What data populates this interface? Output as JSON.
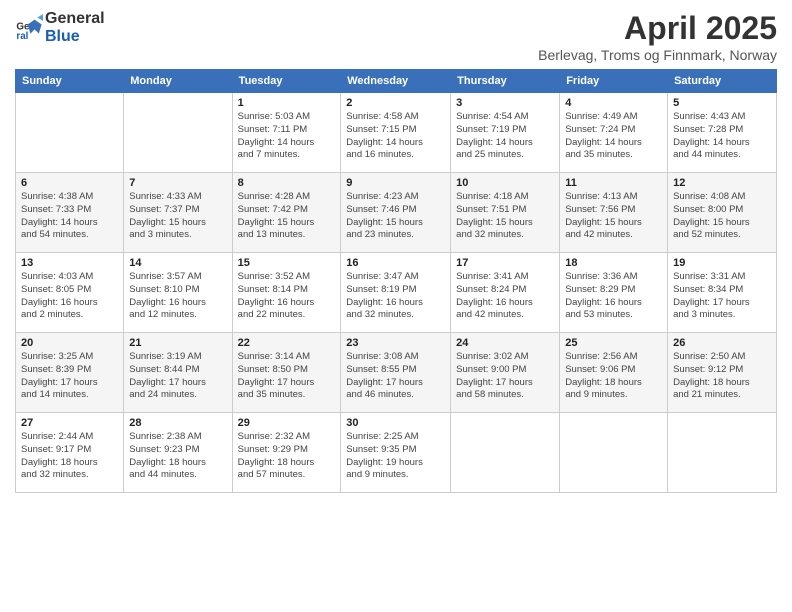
{
  "logo": {
    "text_general": "General",
    "text_blue": "Blue"
  },
  "title": "April 2025",
  "location": "Berlevag, Troms og Finnmark, Norway",
  "days_of_week": [
    "Sunday",
    "Monday",
    "Tuesday",
    "Wednesday",
    "Thursday",
    "Friday",
    "Saturday"
  ],
  "weeks": [
    [
      {
        "day": "",
        "info": ""
      },
      {
        "day": "",
        "info": ""
      },
      {
        "day": "1",
        "info": "Sunrise: 5:03 AM\nSunset: 7:11 PM\nDaylight: 14 hours\nand 7 minutes."
      },
      {
        "day": "2",
        "info": "Sunrise: 4:58 AM\nSunset: 7:15 PM\nDaylight: 14 hours\nand 16 minutes."
      },
      {
        "day": "3",
        "info": "Sunrise: 4:54 AM\nSunset: 7:19 PM\nDaylight: 14 hours\nand 25 minutes."
      },
      {
        "day": "4",
        "info": "Sunrise: 4:49 AM\nSunset: 7:24 PM\nDaylight: 14 hours\nand 35 minutes."
      },
      {
        "day": "5",
        "info": "Sunrise: 4:43 AM\nSunset: 7:28 PM\nDaylight: 14 hours\nand 44 minutes."
      }
    ],
    [
      {
        "day": "6",
        "info": "Sunrise: 4:38 AM\nSunset: 7:33 PM\nDaylight: 14 hours\nand 54 minutes."
      },
      {
        "day": "7",
        "info": "Sunrise: 4:33 AM\nSunset: 7:37 PM\nDaylight: 15 hours\nand 3 minutes."
      },
      {
        "day": "8",
        "info": "Sunrise: 4:28 AM\nSunset: 7:42 PM\nDaylight: 15 hours\nand 13 minutes."
      },
      {
        "day": "9",
        "info": "Sunrise: 4:23 AM\nSunset: 7:46 PM\nDaylight: 15 hours\nand 23 minutes."
      },
      {
        "day": "10",
        "info": "Sunrise: 4:18 AM\nSunset: 7:51 PM\nDaylight: 15 hours\nand 32 minutes."
      },
      {
        "day": "11",
        "info": "Sunrise: 4:13 AM\nSunset: 7:56 PM\nDaylight: 15 hours\nand 42 minutes."
      },
      {
        "day": "12",
        "info": "Sunrise: 4:08 AM\nSunset: 8:00 PM\nDaylight: 15 hours\nand 52 minutes."
      }
    ],
    [
      {
        "day": "13",
        "info": "Sunrise: 4:03 AM\nSunset: 8:05 PM\nDaylight: 16 hours\nand 2 minutes."
      },
      {
        "day": "14",
        "info": "Sunrise: 3:57 AM\nSunset: 8:10 PM\nDaylight: 16 hours\nand 12 minutes."
      },
      {
        "day": "15",
        "info": "Sunrise: 3:52 AM\nSunset: 8:14 PM\nDaylight: 16 hours\nand 22 minutes."
      },
      {
        "day": "16",
        "info": "Sunrise: 3:47 AM\nSunset: 8:19 PM\nDaylight: 16 hours\nand 32 minutes."
      },
      {
        "day": "17",
        "info": "Sunrise: 3:41 AM\nSunset: 8:24 PM\nDaylight: 16 hours\nand 42 minutes."
      },
      {
        "day": "18",
        "info": "Sunrise: 3:36 AM\nSunset: 8:29 PM\nDaylight: 16 hours\nand 53 minutes."
      },
      {
        "day": "19",
        "info": "Sunrise: 3:31 AM\nSunset: 8:34 PM\nDaylight: 17 hours\nand 3 minutes."
      }
    ],
    [
      {
        "day": "20",
        "info": "Sunrise: 3:25 AM\nSunset: 8:39 PM\nDaylight: 17 hours\nand 14 minutes."
      },
      {
        "day": "21",
        "info": "Sunrise: 3:19 AM\nSunset: 8:44 PM\nDaylight: 17 hours\nand 24 minutes."
      },
      {
        "day": "22",
        "info": "Sunrise: 3:14 AM\nSunset: 8:50 PM\nDaylight: 17 hours\nand 35 minutes."
      },
      {
        "day": "23",
        "info": "Sunrise: 3:08 AM\nSunset: 8:55 PM\nDaylight: 17 hours\nand 46 minutes."
      },
      {
        "day": "24",
        "info": "Sunrise: 3:02 AM\nSunset: 9:00 PM\nDaylight: 17 hours\nand 58 minutes."
      },
      {
        "day": "25",
        "info": "Sunrise: 2:56 AM\nSunset: 9:06 PM\nDaylight: 18 hours\nand 9 minutes."
      },
      {
        "day": "26",
        "info": "Sunrise: 2:50 AM\nSunset: 9:12 PM\nDaylight: 18 hours\nand 21 minutes."
      }
    ],
    [
      {
        "day": "27",
        "info": "Sunrise: 2:44 AM\nSunset: 9:17 PM\nDaylight: 18 hours\nand 32 minutes."
      },
      {
        "day": "28",
        "info": "Sunrise: 2:38 AM\nSunset: 9:23 PM\nDaylight: 18 hours\nand 44 minutes."
      },
      {
        "day": "29",
        "info": "Sunrise: 2:32 AM\nSunset: 9:29 PM\nDaylight: 18 hours\nand 57 minutes."
      },
      {
        "day": "30",
        "info": "Sunrise: 2:25 AM\nSunset: 9:35 PM\nDaylight: 19 hours\nand 9 minutes."
      },
      {
        "day": "",
        "info": ""
      },
      {
        "day": "",
        "info": ""
      },
      {
        "day": "",
        "info": ""
      }
    ]
  ]
}
